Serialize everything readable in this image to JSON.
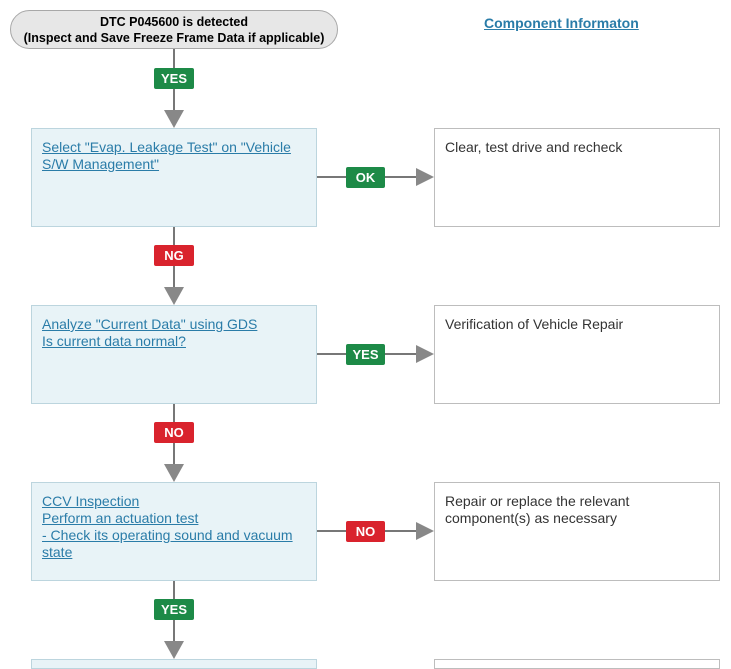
{
  "start": {
    "line1": "DTC P045600 is detected",
    "line2": "(Inspect and Save Freeze Frame Data if applicable)"
  },
  "component_link": "Component Informaton",
  "steps": [
    {
      "lines": [
        "Select \"Evap. Leakage Test\" on \"Vehicle",
        "S/W Management\""
      ]
    },
    {
      "lines": [
        "Analyze \"Current Data\" using GDS",
        "Is current data normal?"
      ]
    },
    {
      "lines": [
        "CCV Inspection",
        "Perform an actuation test",
        "- Check its operating sound and vacuum",
        "state"
      ]
    }
  ],
  "results": [
    {
      "lines": [
        "Clear, test drive and recheck"
      ]
    },
    {
      "lines": [
        "Verification of Vehicle Repair"
      ]
    },
    {
      "lines": [
        "Repair or replace the relevant",
        "component(s) as necessary"
      ]
    }
  ],
  "badges": {
    "start_down": "YES",
    "step1_right": "OK",
    "step1_down": "NG",
    "step2_right": "YES",
    "step2_down": "NO",
    "step3_right": "NO",
    "step3_down": "YES"
  },
  "colors": {
    "yes": "#1d8a47",
    "no": "#d9232d",
    "link": "#2a7ca8"
  }
}
